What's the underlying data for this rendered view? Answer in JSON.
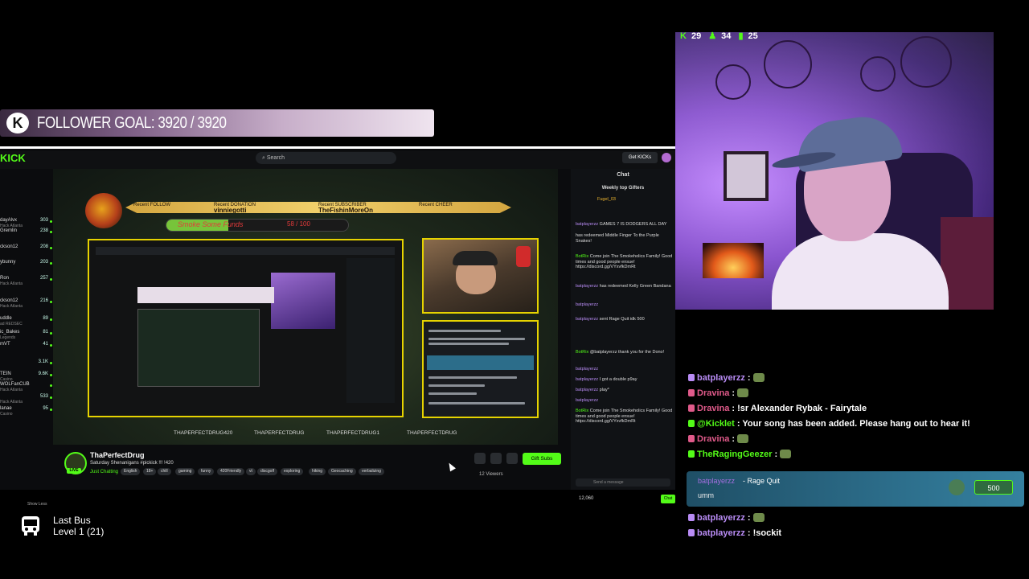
{
  "follower_goal": {
    "label": "FOLLOWER GOAL: 3920 / 3920",
    "icon": "kick-k-icon"
  },
  "browser": {
    "logo": "KICK",
    "search_placeholder": "Search",
    "get_kicks": "Get KICKs",
    "sidebar": [
      {
        "name": "dayAlvx",
        "count": "303",
        "sub": "Hack Atlanta"
      },
      {
        "name": "Gremlin",
        "count": "238",
        "sub": ""
      },
      {
        "name": "ckson12",
        "count": "208",
        "sub": ""
      },
      {
        "name": "ybunny",
        "count": "203",
        "sub": ""
      },
      {
        "name": "Ron",
        "count": "257",
        "sub": "Hack Atlanta"
      },
      {
        "name": "ckson12",
        "count": "216",
        "sub": "Hack Atlanta"
      },
      {
        "name": "uddle",
        "count": "89",
        "sub": "ad REDSEC"
      },
      {
        "name": "ic_Bakes",
        "count": "81",
        "sub": "Legends"
      },
      {
        "name": "mVT",
        "count": "41",
        "sub": ""
      },
      {
        "name": "",
        "count": "3.1K",
        "sub": ""
      },
      {
        "name": "TEIN",
        "count": "9.6K",
        "sub": "Casino"
      },
      {
        "name": "WOLFanCUB",
        "count": "",
        "sub": "Hack Atlanta"
      },
      {
        "name": "",
        "count": "533",
        "sub": "Hack Atlanta"
      },
      {
        "name": "lanae",
        "count": "95",
        "sub": "Casino"
      }
    ],
    "show_less": "Show Less"
  },
  "stream_overlay": {
    "recent_follow_label": "Recent FOLLOW",
    "recent_donation_label": "Recent DONATION",
    "recent_donation_name": "vinniegotti",
    "recent_subscriber_label": "Recent SUBSCRIBER",
    "recent_subscriber_name": "TheFishinMoreOn",
    "recent_cheer_label": "Recent CHEER",
    "funds_label": "Smoke Some Funds",
    "funds_value": "58 / 100",
    "funds_progress": 0.58,
    "socials": [
      "THAPERFECTDRUG420",
      "THAPERFECTDRUG",
      "THAPERFECTDRUG1",
      "THAPERFECTDRUG"
    ]
  },
  "stream_info": {
    "streamer": "ThaPerfectDrug",
    "title": "Saturday Shenanigans #pickick !!! !420",
    "category": "Just Chatting",
    "live_badge": "LIVE",
    "tags": [
      "English",
      "18+",
      "chill",
      "gaming",
      "funny",
      "420Friendly",
      "vt",
      "discgolf",
      "exploring",
      "hiking",
      "Geocaching",
      "verbalizing"
    ],
    "gift_subs": "Gift Subs",
    "viewers": "12 Viewers"
  },
  "captured_chat": {
    "header": "Chat",
    "weekly_top": "Weekly top Gifters",
    "gifter": "Fugel_03",
    "messages": [
      {
        "user": "batplayerzz",
        "text": "GAMES 7 IS DODGERS ALL DAY"
      },
      {
        "user": "",
        "text": "has redeemed Middle Finger To the Purple Snakes!"
      },
      {
        "user": "BotRix",
        "text": "Come join The Smokeholics Family! Good times and good people ensue! https://discord.gg/VYxvfkDmRt"
      },
      {
        "user": "batplayerzz",
        "text": "has redeemed Kelly Green Bandana"
      },
      {
        "user": "batplayerzz",
        "text": ""
      },
      {
        "user": "batplayerzz",
        "text": "sent Rage Quit idk 500"
      },
      {
        "user": "BotRix",
        "text": "@batplayerzz thank you for the Dono!"
      },
      {
        "user": "batplayerzz",
        "text": ""
      },
      {
        "user": "batplayerzz",
        "text": "I got a double p9ay"
      },
      {
        "user": "batplayerzz",
        "text": "play*"
      },
      {
        "user": "batplayerzz",
        "text": ""
      },
      {
        "user": "BotRix",
        "text": "Come join The Smokeholics Family! Good times and good people ensue! https://discord.gg/VYxvfkDmRt"
      }
    ],
    "send_placeholder": "Send a message",
    "count": "12,060",
    "chat_button": "Chat"
  },
  "webcam_hud": {
    "kicks": "29",
    "followers": "34",
    "subs": "25"
  },
  "overlay_chat": [
    {
      "user": "batplayerzz",
      "text": ":",
      "user_color": "#b98cf5",
      "emote": true
    },
    {
      "user": "Dravina",
      "text": ":",
      "user_color": "#e05a8a",
      "emote": true
    },
    {
      "user": "Dravina",
      "text": ": !sr Alexander Rybak - Fairytale",
      "user_color": "#e05a8a",
      "emote": false
    },
    {
      "user": "@Kicklet",
      "text": ": Your song has been added. Please hang out to hear it!",
      "user_color": "#53fc18",
      "emote": false
    },
    {
      "user": "Dravina",
      "text": ":",
      "user_color": "#e05a8a",
      "emote": true
    },
    {
      "user": "TheRagingGeezer",
      "text": ":",
      "user_color": "#53fc18",
      "emote": true
    }
  ],
  "overlay_redeem": {
    "user": "batplayerzz",
    "reward": "- Rage Quit",
    "message": "umm",
    "points": "500"
  },
  "overlay_chat_after": [
    {
      "user": "batplayerzz",
      "text": ":",
      "user_color": "#b98cf5",
      "emote": true
    },
    {
      "user": "batplayerzz",
      "text": ": !sockit",
      "user_color": "#b98cf5",
      "emote": false
    }
  ],
  "now_playing": {
    "title": "Last Bus",
    "subtitle": "Level 1  (21)"
  },
  "colors": {
    "kick_green": "#53fc18",
    "goal_bar": "#c7aec9",
    "frame_yellow": "#e6d300"
  }
}
